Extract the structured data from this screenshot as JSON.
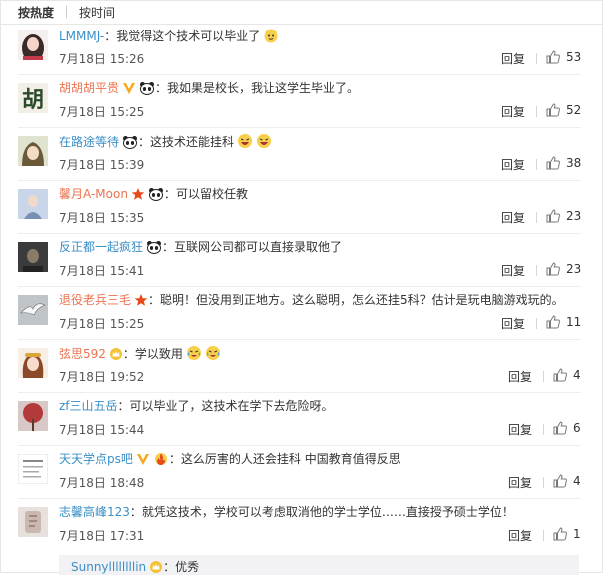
{
  "tabs": [
    {
      "label": "按热度",
      "active": true
    },
    {
      "label": "按时间",
      "active": false
    }
  ],
  "reply_label": "回复",
  "comments": [
    {
      "user": "LMMMJ-",
      "sep": "：",
      "text": "我觉得这个技术可以毕业了",
      "emoji": [
        "cat-emoji"
      ],
      "time": "7月18日 15:26",
      "likes": "53",
      "badges": []
    },
    {
      "user": "胡胡胡平贵",
      "sep": "：",
      "text": "我如果是校长，我让这学生毕业了。",
      "emoji": [],
      "time": "7月18日 15:25",
      "likes": "52",
      "badges": [
        "vip-v-badge",
        "panda-badge"
      ],
      "avatar_text": "胡"
    },
    {
      "user": "在路途等待",
      "sep": "：",
      "text": "这技术还能挂科",
      "emoji": [
        "laugh-emoji",
        "laugh-emoji"
      ],
      "time": "7月18日 15:39",
      "likes": "38",
      "badges": [
        "panda-badge"
      ]
    },
    {
      "user": "馨月A-Moon",
      "sep": "：",
      "text": "可以留校任教",
      "emoji": [],
      "time": "7月18日 15:35",
      "likes": "23",
      "badges": [
        "star-badge",
        "panda-badge"
      ]
    },
    {
      "user": "反正都一起疯狂",
      "sep": "：",
      "text": "互联网公司都可以直接录取他了",
      "emoji": [],
      "time": "7月18日 15:41",
      "likes": "23",
      "badges": [
        "panda-badge"
      ]
    },
    {
      "user": "退役老兵三毛",
      "sep": "：",
      "text": "聪明！但没用到正地方。这么聪明，怎么还挂5科？估计是玩电脑游戏玩的。",
      "emoji": [],
      "time": "7月18日 15:25",
      "likes": "11",
      "badges": [
        "star-badge"
      ]
    },
    {
      "user": "弦思592",
      "sep": "：",
      "text": "学以致用",
      "emoji": [
        "cry-laugh-emoji",
        "cry-laugh-emoji"
      ],
      "time": "7月18日 19:52",
      "likes": "4",
      "badges": [
        "crown-badge"
      ]
    },
    {
      "user": "zf三山五岳",
      "sep": "：",
      "text": "可以毕业了，这技术在学下去危险呀。",
      "emoji": [],
      "time": "7月18日 15:44",
      "likes": "6",
      "badges": []
    },
    {
      "user": "天天学点ps吧",
      "sep": "：",
      "text": "这么厉害的人还会挂科 中国教育值得反思",
      "emoji": [],
      "time": "7月18日 18:48",
      "likes": "4",
      "badges": [
        "vip-v-badge",
        "fire-badge"
      ]
    },
    {
      "user": "志馨高峰123",
      "sep": "：",
      "text": "就凭这技术，学校可以考虑取消他的学士学位……直接授予硕士学位！",
      "emoji": [],
      "time": "7月18日 17:31",
      "likes": "1",
      "badges": []
    }
  ],
  "sub_reply": {
    "user": "Sunnyllllllllin",
    "sep": "：",
    "text": "优秀",
    "badges": [
      "crown-badge"
    ]
  }
}
